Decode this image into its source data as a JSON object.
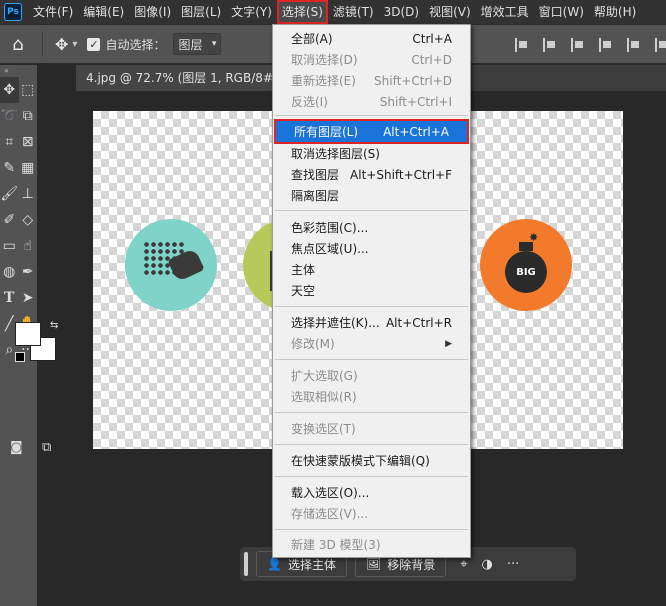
{
  "menubar": {
    "logo": "Ps",
    "items": [
      "文件(F)",
      "编辑(E)",
      "图像(I)",
      "图层(L)",
      "文字(Y)",
      "选择(S)",
      "滤镜(T)",
      "3D(D)",
      "视图(V)",
      "增效工具",
      "窗口(W)",
      "帮助(H)"
    ]
  },
  "options": {
    "auto_select_label": "自动选择：",
    "auto_select_checked": true,
    "layer_select_value": "图层"
  },
  "document": {
    "tab_title": "4.jpg @ 72.7% (图层 1, RGB/8#) *",
    "close_glyph": "×"
  },
  "canvas": {
    "bomb_label": "BIG",
    "colors": {
      "teal": "#7fd3c8",
      "green": "#b7c95a",
      "orange": "#f47a2b"
    }
  },
  "context_bar": {
    "select_subject_label": "选择主体",
    "remove_bg_label": "移除背景"
  },
  "select_menu": {
    "items": [
      {
        "label": "全部(A)",
        "shortcut": "Ctrl+A",
        "disabled": false
      },
      {
        "label": "取消选择(D)",
        "shortcut": "Ctrl+D",
        "disabled": true
      },
      {
        "label": "重新选择(E)",
        "shortcut": "Shift+Ctrl+D",
        "disabled": true
      },
      {
        "label": "反选(I)",
        "shortcut": "Shift+Ctrl+I",
        "disabled": true
      },
      {
        "label": "所有图层(L)",
        "shortcut": "Alt+Ctrl+A",
        "disabled": false,
        "highlighted": true
      },
      {
        "label": "取消选择图层(S)",
        "shortcut": "",
        "disabled": false
      },
      {
        "label": "查找图层",
        "shortcut": "Alt+Shift+Ctrl+F",
        "disabled": false
      },
      {
        "label": "隔离图层",
        "shortcut": "",
        "disabled": false
      },
      {
        "label": "色彩范围(C)...",
        "shortcut": "",
        "disabled": false
      },
      {
        "label": "焦点区域(U)...",
        "shortcut": "",
        "disabled": false
      },
      {
        "label": "主体",
        "shortcut": "",
        "disabled": false
      },
      {
        "label": "天空",
        "shortcut": "",
        "disabled": false
      },
      {
        "label": "选择并遮住(K)...",
        "shortcut": "Alt+Ctrl+R",
        "disabled": false
      },
      {
        "label": "修改(M)",
        "shortcut": "",
        "disabled": true,
        "submenu": true
      },
      {
        "label": "扩大选取(G)",
        "shortcut": "",
        "disabled": true
      },
      {
        "label": "选取相似(R)",
        "shortcut": "",
        "disabled": true
      },
      {
        "label": "变换选区(T)",
        "shortcut": "",
        "disabled": true
      },
      {
        "label": "在快速蒙版模式下编辑(Q)",
        "shortcut": "",
        "disabled": false
      },
      {
        "label": "载入选区(O)...",
        "shortcut": "",
        "disabled": false
      },
      {
        "label": "存储选区(V)...",
        "shortcut": "",
        "disabled": true
      },
      {
        "label": "新建 3D 模型(3)",
        "shortcut": "",
        "disabled": true
      }
    ]
  }
}
